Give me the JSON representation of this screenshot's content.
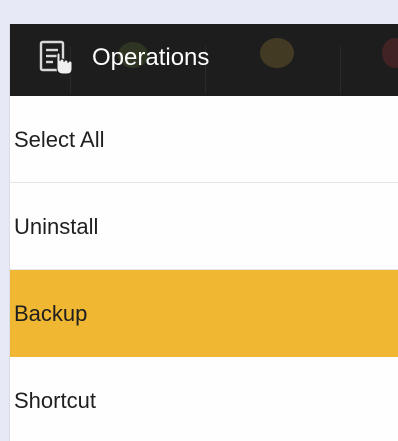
{
  "header": {
    "title": "Operations",
    "icon": "operations-list-icon",
    "background_color": "#1d1d1d",
    "title_color": "#ffffff"
  },
  "menu": {
    "items": [
      {
        "label": "Select All",
        "selected": false
      },
      {
        "label": "Uninstall",
        "selected": false
      },
      {
        "label": "Backup",
        "selected": true
      },
      {
        "label": "Shortcut",
        "selected": false
      }
    ],
    "selected_color": "#f0b733",
    "background_color": "#fefefe"
  },
  "backdrop_color": "#e7e9f6"
}
